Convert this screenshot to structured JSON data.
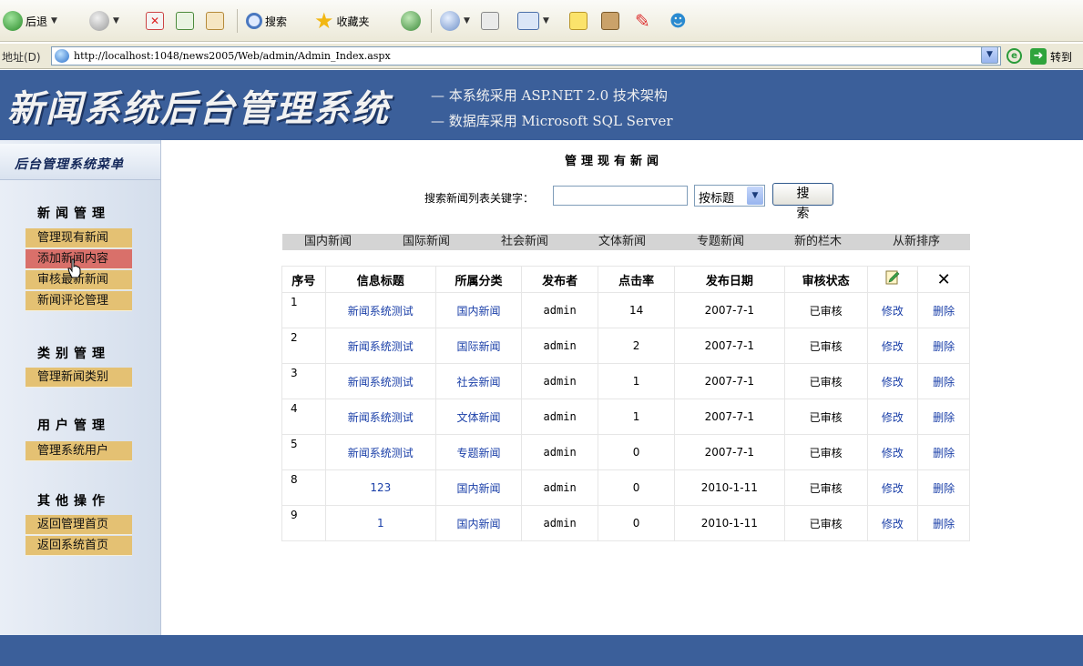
{
  "toolbar": {
    "back_label": "后退",
    "search_label": "搜索",
    "favorites_label": "收藏夹"
  },
  "address": {
    "label": "地址(D)",
    "url": "http://localhost:1048/news2005/Web/admin/Admin_Index.aspx",
    "go_label": "转到"
  },
  "banner": {
    "title": "新闻系统后台管理系统",
    "line1": "— 本系统采用 ASP.NET 2.0 技术架构",
    "line2": "— 数据库采用 Microsoft SQL Server"
  },
  "sidebar": {
    "header": "后台管理系统菜单",
    "groups": [
      {
        "title": "新闻管理",
        "items": [
          "管理现有新闻",
          "添加新闻内容",
          "审核最新新闻",
          "新闻评论管理"
        ]
      },
      {
        "title": "类别管理",
        "items": [
          "管理新闻类别"
        ]
      },
      {
        "title": "用户管理",
        "items": [
          "管理系统用户"
        ]
      },
      {
        "title": "其他操作",
        "items": [
          "返回管理首页",
          "返回系统首页"
        ]
      }
    ]
  },
  "main": {
    "title": "管理现有新闻",
    "search": {
      "label": "搜索新闻列表关键字：",
      "value": "",
      "select_value": "按标题",
      "button_label": "搜 索"
    },
    "categories": [
      "国内新闻",
      "国际新闻",
      "社会新闻",
      "文体新闻",
      "专题新闻",
      "新的栏木",
      "从新排序"
    ],
    "table": {
      "headers": [
        "序号",
        "信息标题",
        "所属分类",
        "发布者",
        "点击率",
        "发布日期",
        "审核状态"
      ],
      "rows": [
        {
          "id": "1",
          "title": "新闻系统测试",
          "category": "国内新闻",
          "author": "admin",
          "clicks": "14",
          "date": "2007-7-1",
          "status": "已审核",
          "edit": "修改",
          "delete": "删除"
        },
        {
          "id": "2",
          "title": "新闻系统测试",
          "category": "国际新闻",
          "author": "admin",
          "clicks": "2",
          "date": "2007-7-1",
          "status": "已审核",
          "edit": "修改",
          "delete": "删除"
        },
        {
          "id": "3",
          "title": "新闻系统测试",
          "category": "社会新闻",
          "author": "admin",
          "clicks": "1",
          "date": "2007-7-1",
          "status": "已审核",
          "edit": "修改",
          "delete": "删除"
        },
        {
          "id": "4",
          "title": "新闻系统测试",
          "category": "文体新闻",
          "author": "admin",
          "clicks": "1",
          "date": "2007-7-1",
          "status": "已审核",
          "edit": "修改",
          "delete": "删除"
        },
        {
          "id": "5",
          "title": "新闻系统测试",
          "category": "专题新闻",
          "author": "admin",
          "clicks": "0",
          "date": "2007-7-1",
          "status": "已审核",
          "edit": "修改",
          "delete": "删除"
        },
        {
          "id": "8",
          "title": "123",
          "category": "国内新闻",
          "author": "admin",
          "clicks": "0",
          "date": "2010-1-11",
          "status": "已审核",
          "edit": "修改",
          "delete": "删除"
        },
        {
          "id": "9",
          "title": "1",
          "category": "国内新闻",
          "author": "admin",
          "clicks": "0",
          "date": "2010-1-11",
          "status": "已审核",
          "edit": "修改",
          "delete": "删除"
        }
      ]
    }
  }
}
